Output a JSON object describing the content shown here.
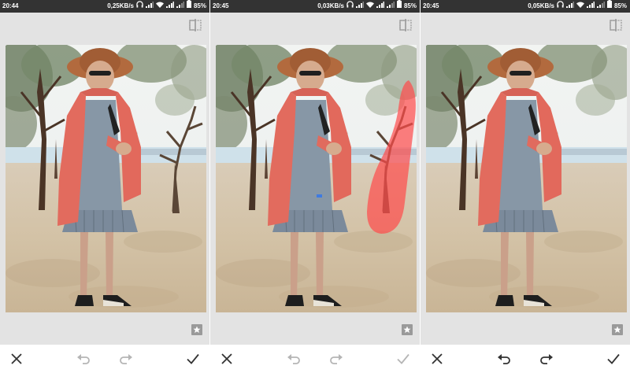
{
  "screens": [
    {
      "status": {
        "time": "20:44",
        "speed": "0,25KB/s",
        "battery": "85%"
      },
      "brush_stroke": false,
      "undo_enabled": false,
      "redo_enabled": false,
      "apply_enabled": true
    },
    {
      "status": {
        "time": "20:45",
        "speed": "0,03KB/s",
        "battery": "85%"
      },
      "brush_stroke": true,
      "undo_enabled": false,
      "redo_enabled": false,
      "apply_enabled": false
    },
    {
      "status": {
        "time": "20:45",
        "speed": "0,05KB/s",
        "battery": "85%"
      },
      "brush_stroke": false,
      "undo_enabled": true,
      "redo_enabled": true,
      "apply_enabled": true
    }
  ],
  "icons": {
    "cancel": "close-icon",
    "undo": "undo-icon",
    "redo": "redo-icon",
    "apply": "checkmark-icon",
    "compare": "compare-icon",
    "bookmark": "star-bookmark-icon"
  },
  "colors": {
    "status_bar": "#333333",
    "panel_bg": "#e3e3e3",
    "brush": "#ff4a4a",
    "icon_active": "#333333",
    "icon_disabled": "#b5b5b5"
  }
}
